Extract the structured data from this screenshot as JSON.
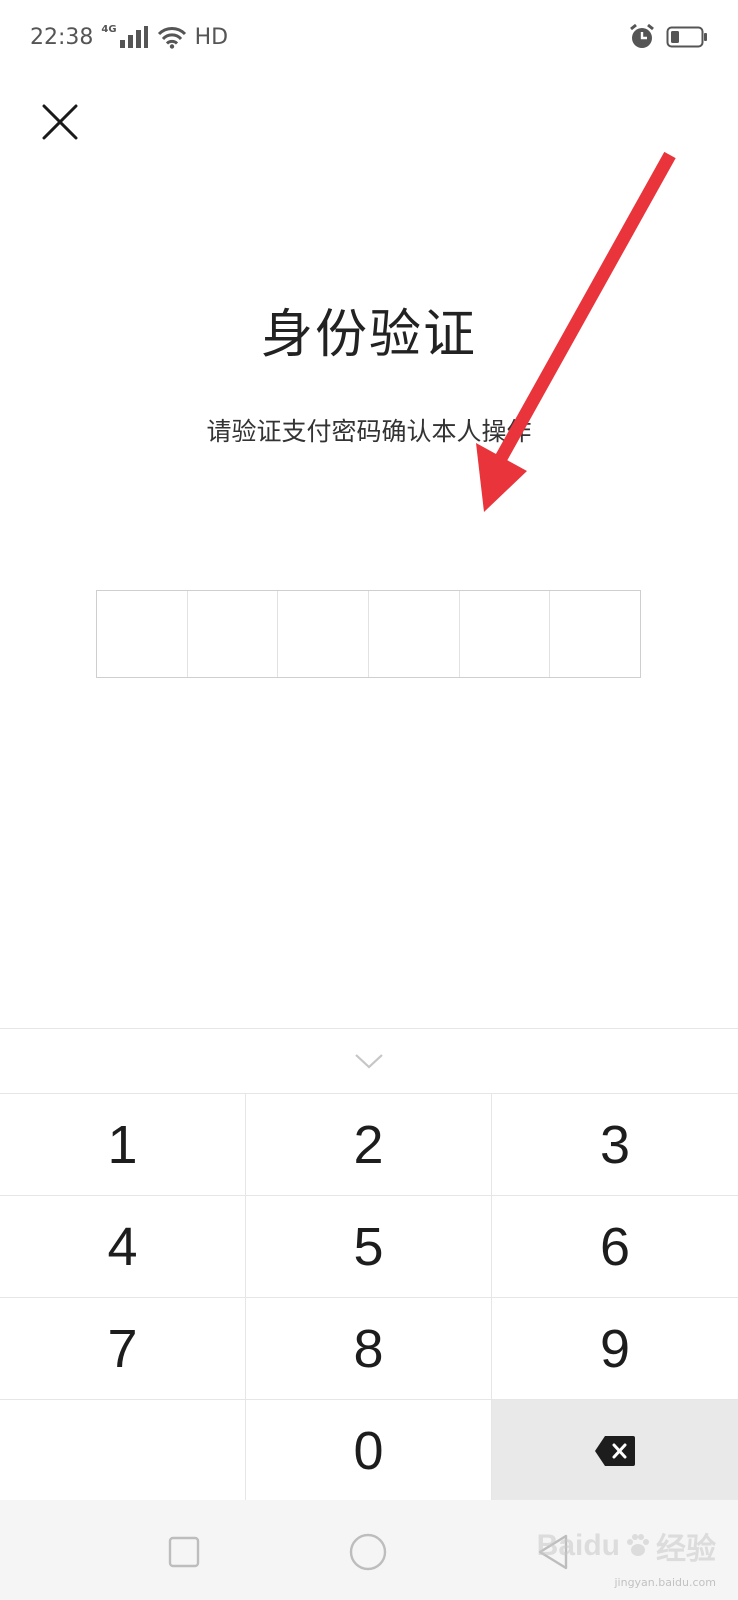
{
  "status_bar": {
    "time": "22:38",
    "network": "4G",
    "network_quality": "HD",
    "icons": [
      "signal-icon",
      "wifi-icon",
      "alarm-icon",
      "battery-icon"
    ]
  },
  "title": "身份验证",
  "subtitle": "请验证支付密码确认本人操作",
  "password": {
    "length": 6,
    "filled": 0
  },
  "keyboard": {
    "collapse_icon": "chevron-down-icon",
    "keys": [
      "1",
      "2",
      "3",
      "4",
      "5",
      "6",
      "7",
      "8",
      "9",
      "",
      "0",
      "delete"
    ]
  },
  "nav": {
    "buttons": [
      "recent-apps",
      "home",
      "back"
    ]
  },
  "watermark": {
    "brand": "Baidu",
    "brand_cn": "经验",
    "url": "jingyan.baidu.com"
  },
  "colors": {
    "arrow": "#e8343a",
    "delete_key_bg": "#e9e9e9",
    "nav_bg": "#f5f5f5"
  }
}
